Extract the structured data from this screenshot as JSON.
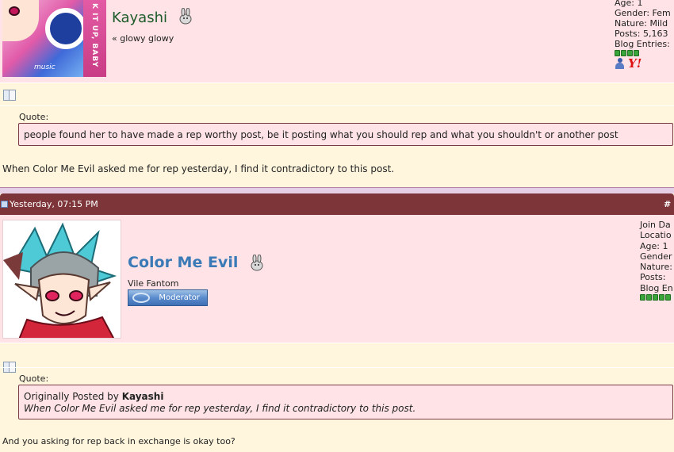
{
  "post1": {
    "username": "Kayashi",
    "subtitle": "« glowy glowy",
    "avatar_caption": "music",
    "avatar_stripe_text": "K IT UP, BABY",
    "userinfo": [
      "Age: 1",
      "Gender: Fem",
      "Nature: Mild",
      "Posts: 5,163",
      "Blog Entries:"
    ],
    "quote_label": "Quote:",
    "quote_text": "people found her to have made a rep worthy post, be it posting what you should rep and what you shouldn't or another post",
    "body_text": "When Color Me Evil asked me for rep yesterday, I find it contradictory to this post."
  },
  "post2": {
    "date": "Yesterday, 07:15 PM",
    "post_number": "#",
    "username": "Color Me Evil",
    "user_title": "Vile Fantom",
    "badge": "Moderator",
    "userinfo": [
      "Join Da",
      "Locatio",
      "Age: 1",
      "Gender",
      "Nature:",
      "Posts: ",
      "Blog En"
    ],
    "quote_label": "Quote:",
    "quote_originally": "Originally Posted by",
    "quote_author": "Kayashi",
    "quote_text": "When Color Me Evil asked me for rep yesterday, I find it contradictory to this post.",
    "body_text": "And you asking for rep back in exchange is okay too?"
  },
  "colors": {
    "header_bar": "#7e3539",
    "post_bg": "#ffe3e6",
    "page_bg": "#fff6dd",
    "username1": "#1c5b2a",
    "username2": "#3a7ab6"
  },
  "icons": [
    "bunny-icon",
    "user-online-icon",
    "yahoo-icon",
    "post-doc-icon",
    "post-status-icon"
  ]
}
